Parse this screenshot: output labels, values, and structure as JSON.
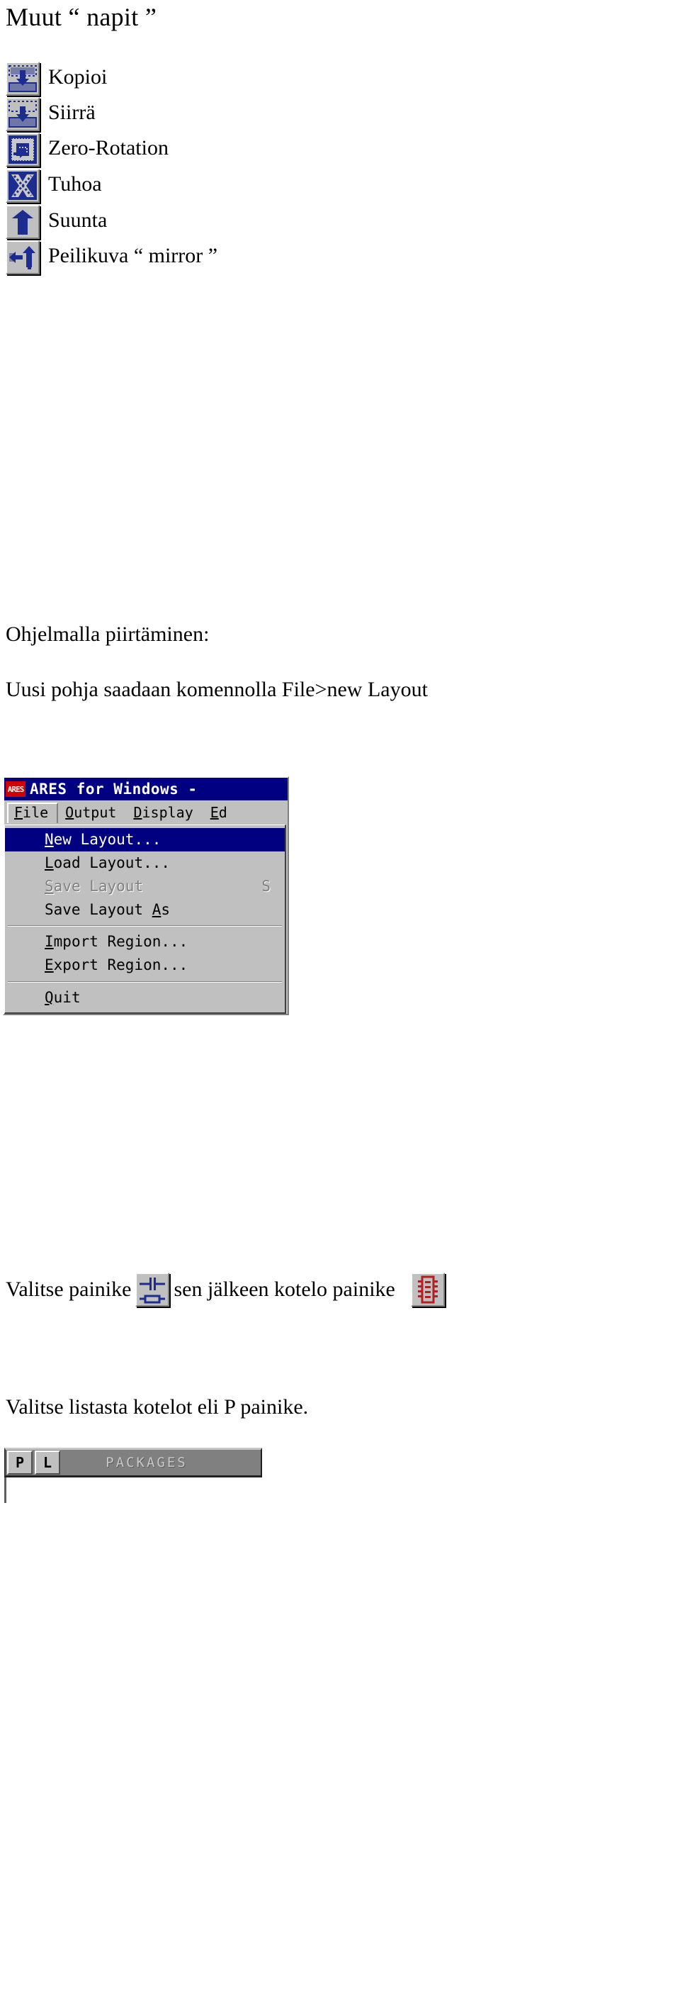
{
  "document": {
    "heading": "Muut “ napit ”",
    "section_heading": "Ohjelmalla piirtäminen:",
    "new_layout_sentence": "Uusi pohja saadaan komennolla File>new Layout",
    "select_button_prefix": "Valitse painike",
    "select_button_middle": "sen jälkeen kotelo painike",
    "select_list_sentence": "Valitse listasta kotelot eli P painike."
  },
  "toolbar": {
    "buttons": [
      {
        "label": "Kopioi",
        "icon": "copy-icon"
      },
      {
        "label": "Siirrä",
        "icon": "move-icon"
      },
      {
        "label": "Zero-Rotation",
        "icon": "zero-rotation-icon"
      },
      {
        "label": "Tuhoa",
        "icon": "delete-icon"
      },
      {
        "label": "Suunta",
        "icon": "orientation-icon"
      },
      {
        "label": "Peilikuva “ mirror ”",
        "icon": "mirror-icon"
      }
    ]
  },
  "ares_window": {
    "title": "ARES for Windows -",
    "logo_text": "ARES",
    "menubar": [
      {
        "label": "File",
        "mnemonic": "F",
        "open": true
      },
      {
        "label": "Output",
        "mnemonic": "O",
        "open": false
      },
      {
        "label": "Display",
        "mnemonic": "D",
        "open": false
      },
      {
        "label": "Ed",
        "mnemonic": "E",
        "open": false
      }
    ],
    "file_menu": [
      {
        "label": "New Layout...",
        "mnemonic": "N",
        "state": "selected",
        "accel": ""
      },
      {
        "label": "Load Layout...",
        "mnemonic": "L",
        "state": "normal",
        "accel": ""
      },
      {
        "label": "Save Layout",
        "mnemonic": "S",
        "state": "disabled",
        "accel": "S"
      },
      {
        "label": "Save Layout As",
        "mnemonic": "A",
        "state": "normal",
        "accel": ""
      },
      {
        "label": "__sep__",
        "state": "separator"
      },
      {
        "label": "Import Region...",
        "mnemonic": "I",
        "state": "normal",
        "accel": ""
      },
      {
        "label": "Export Region...",
        "mnemonic": "E",
        "state": "normal",
        "accel": ""
      },
      {
        "label": "__sep__",
        "state": "separator"
      },
      {
        "label": "Quit",
        "mnemonic": "Q",
        "state": "normal",
        "accel": ""
      }
    ]
  },
  "inline_icons": {
    "component_button": "component-mode-icon",
    "package_button": "package-mode-icon"
  },
  "packages_bar": {
    "buttons": [
      "P",
      "L"
    ],
    "title": "PACKAGES"
  },
  "colors": {
    "glyph_blue": "#1d2d8f",
    "face": "#c0c0c0",
    "titlebar": "#000080",
    "logo_red": "#d00000"
  }
}
